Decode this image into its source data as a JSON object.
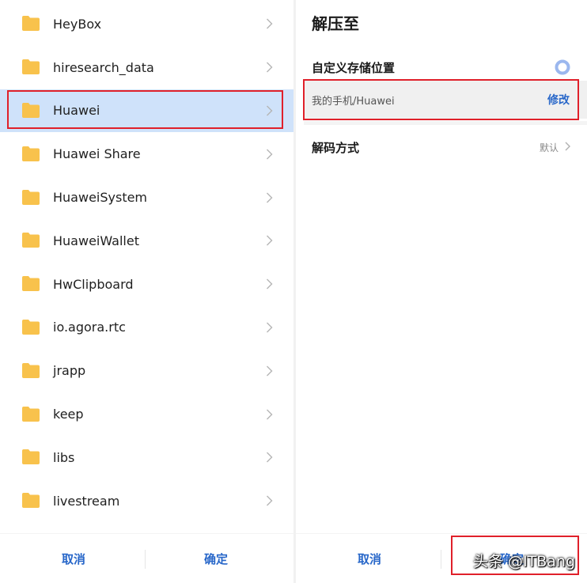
{
  "left_panel": {
    "folders": [
      {
        "name": "HeyBox"
      },
      {
        "name": "hiresearch_data"
      },
      {
        "name": "Huawei",
        "selected": true
      },
      {
        "name": "Huawei Share"
      },
      {
        "name": "HuaweiSystem"
      },
      {
        "name": "HuaweiWallet"
      },
      {
        "name": "HwClipboard"
      },
      {
        "name": "io.agora.rtc"
      },
      {
        "name": "jrapp"
      },
      {
        "name": "keep"
      },
      {
        "name": "libs"
      },
      {
        "name": "livestream"
      }
    ],
    "cancel_label": "取消",
    "confirm_label": "确定"
  },
  "right_panel": {
    "title": "解压至",
    "custom_location_label": "自定义存储位置",
    "path": "我的手机/Huawei",
    "edit_label": "修改",
    "decode_label": "解码方式",
    "decode_value": "默认",
    "cancel_label": "取消",
    "confirm_label": "确定"
  },
  "watermark": "头条 @ITBang",
  "colors": {
    "accent": "#2867c9",
    "selected_row": "#cfe2fa",
    "folder": "#f8c24c",
    "highlight": "#e0202a",
    "radio": "#9bb7ee"
  },
  "icons": [
    "folder-icon",
    "chevron-right-icon",
    "radio-icon"
  ]
}
